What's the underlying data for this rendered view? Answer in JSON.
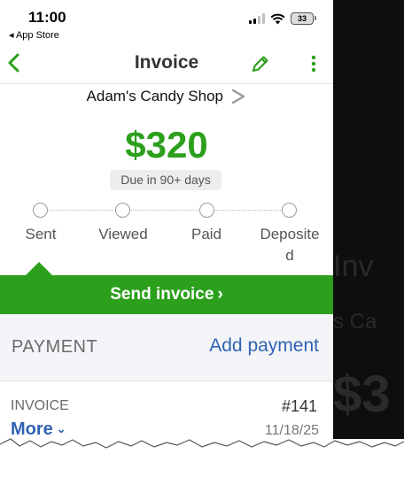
{
  "status": {
    "time": "11:00",
    "back_app": "◂ App Store",
    "battery": "33"
  },
  "nav": {
    "title": "Invoice"
  },
  "customer": {
    "name": "Adam's Candy Shop"
  },
  "invoice": {
    "amount": "$320",
    "due": "Due in 90+ days",
    "number": "#141",
    "date": "11/18/25",
    "label": "INVOICE"
  },
  "steps": [
    "Sent",
    "Viewed",
    "Paid",
    "Deposite",
    "d"
  ],
  "send_button": {
    "label": "Send invoice",
    "chevron": "›"
  },
  "payment": {
    "label": "PAYMENT",
    "add_label": "Add payment"
  },
  "more": {
    "label": "More",
    "chevron": "⌄"
  },
  "background_ghost": {
    "line1": "Inv",
    "line2": "s Ca",
    "line3": "$3"
  },
  "colors": {
    "brand_green": "#2ca01c",
    "link_blue": "#2f63b5",
    "section_bg": "#f4f5f8"
  },
  "icons": [
    "chevron-left-icon",
    "pencil-icon",
    "more-vertical-icon",
    "chevron-right-icon",
    "signal-icon",
    "wifi-icon",
    "battery-icon"
  ]
}
